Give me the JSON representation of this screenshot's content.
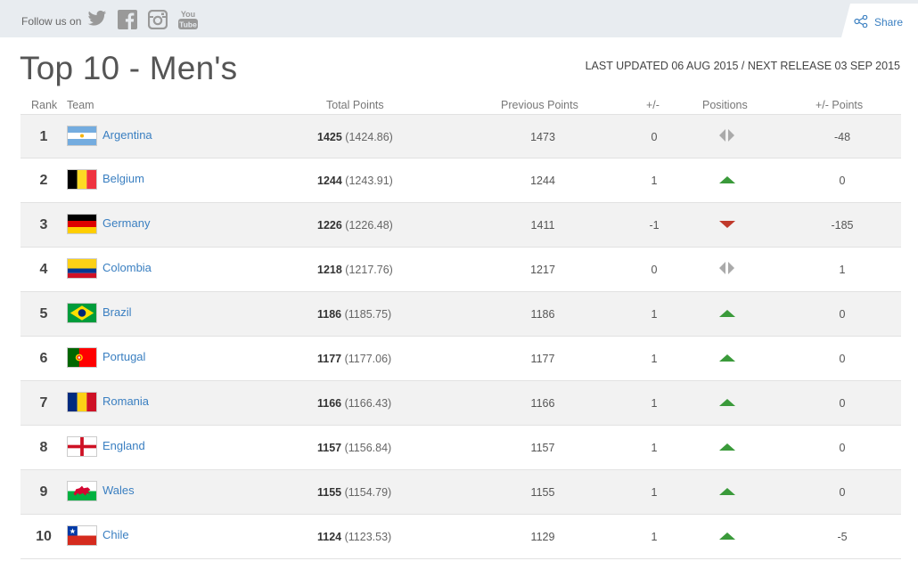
{
  "topbar": {
    "follow_label": "Follow us on",
    "social": [
      "twitter-icon",
      "facebook-icon",
      "instagram-icon",
      "youtube-icon"
    ],
    "youtube_text": [
      "You",
      "Tube"
    ],
    "share_label": "Share"
  },
  "page": {
    "title": "Top 10 - Men's",
    "updated": "LAST UPDATED 06 AUG 2015 / NEXT RELEASE 03 SEP 2015"
  },
  "table": {
    "headers": {
      "rank": "Rank",
      "team": "Team",
      "total": "Total Points",
      "previous": "Previous Points",
      "diff": "+/-",
      "positions": "Positions",
      "points_diff": "+/- Points"
    },
    "rows": [
      {
        "rank": "1",
        "team": "Argentina",
        "flag": "argentina",
        "points": "1425",
        "exact": "(1424.86)",
        "previous": "1473",
        "diff": "0",
        "movement": "same",
        "points_diff": "-48"
      },
      {
        "rank": "2",
        "team": "Belgium",
        "flag": "belgium",
        "points": "1244",
        "exact": "(1243.91)",
        "previous": "1244",
        "diff": "1",
        "movement": "up",
        "points_diff": "0"
      },
      {
        "rank": "3",
        "team": "Germany",
        "flag": "germany",
        "points": "1226",
        "exact": "(1226.48)",
        "previous": "1411",
        "diff": "-1",
        "movement": "down",
        "points_diff": "-185"
      },
      {
        "rank": "4",
        "team": "Colombia",
        "flag": "colombia",
        "points": "1218",
        "exact": "(1217.76)",
        "previous": "1217",
        "diff": "0",
        "movement": "same",
        "points_diff": "1"
      },
      {
        "rank": "5",
        "team": "Brazil",
        "flag": "brazil",
        "points": "1186",
        "exact": "(1185.75)",
        "previous": "1186",
        "diff": "1",
        "movement": "up",
        "points_diff": "0"
      },
      {
        "rank": "6",
        "team": "Portugal",
        "flag": "portugal",
        "points": "1177",
        "exact": "(1177.06)",
        "previous": "1177",
        "diff": "1",
        "movement": "up",
        "points_diff": "0"
      },
      {
        "rank": "7",
        "team": "Romania",
        "flag": "romania",
        "points": "1166",
        "exact": "(1166.43)",
        "previous": "1166",
        "diff": "1",
        "movement": "up",
        "points_diff": "0"
      },
      {
        "rank": "8",
        "team": "England",
        "flag": "england",
        "points": "1157",
        "exact": "(1156.84)",
        "previous": "1157",
        "diff": "1",
        "movement": "up",
        "points_diff": "0"
      },
      {
        "rank": "9",
        "team": "Wales",
        "flag": "wales",
        "points": "1155",
        "exact": "(1154.79)",
        "previous": "1155",
        "diff": "1",
        "movement": "up",
        "points_diff": "0"
      },
      {
        "rank": "10",
        "team": "Chile",
        "flag": "chile",
        "points": "1124",
        "exact": "(1123.53)",
        "previous": "1129",
        "diff": "1",
        "movement": "up",
        "points_diff": "-5"
      }
    ]
  },
  "colors": {
    "link": "#3a7fc1",
    "up": "#3a9a3a",
    "down": "#c0392b",
    "same": "#aaaaaa"
  }
}
